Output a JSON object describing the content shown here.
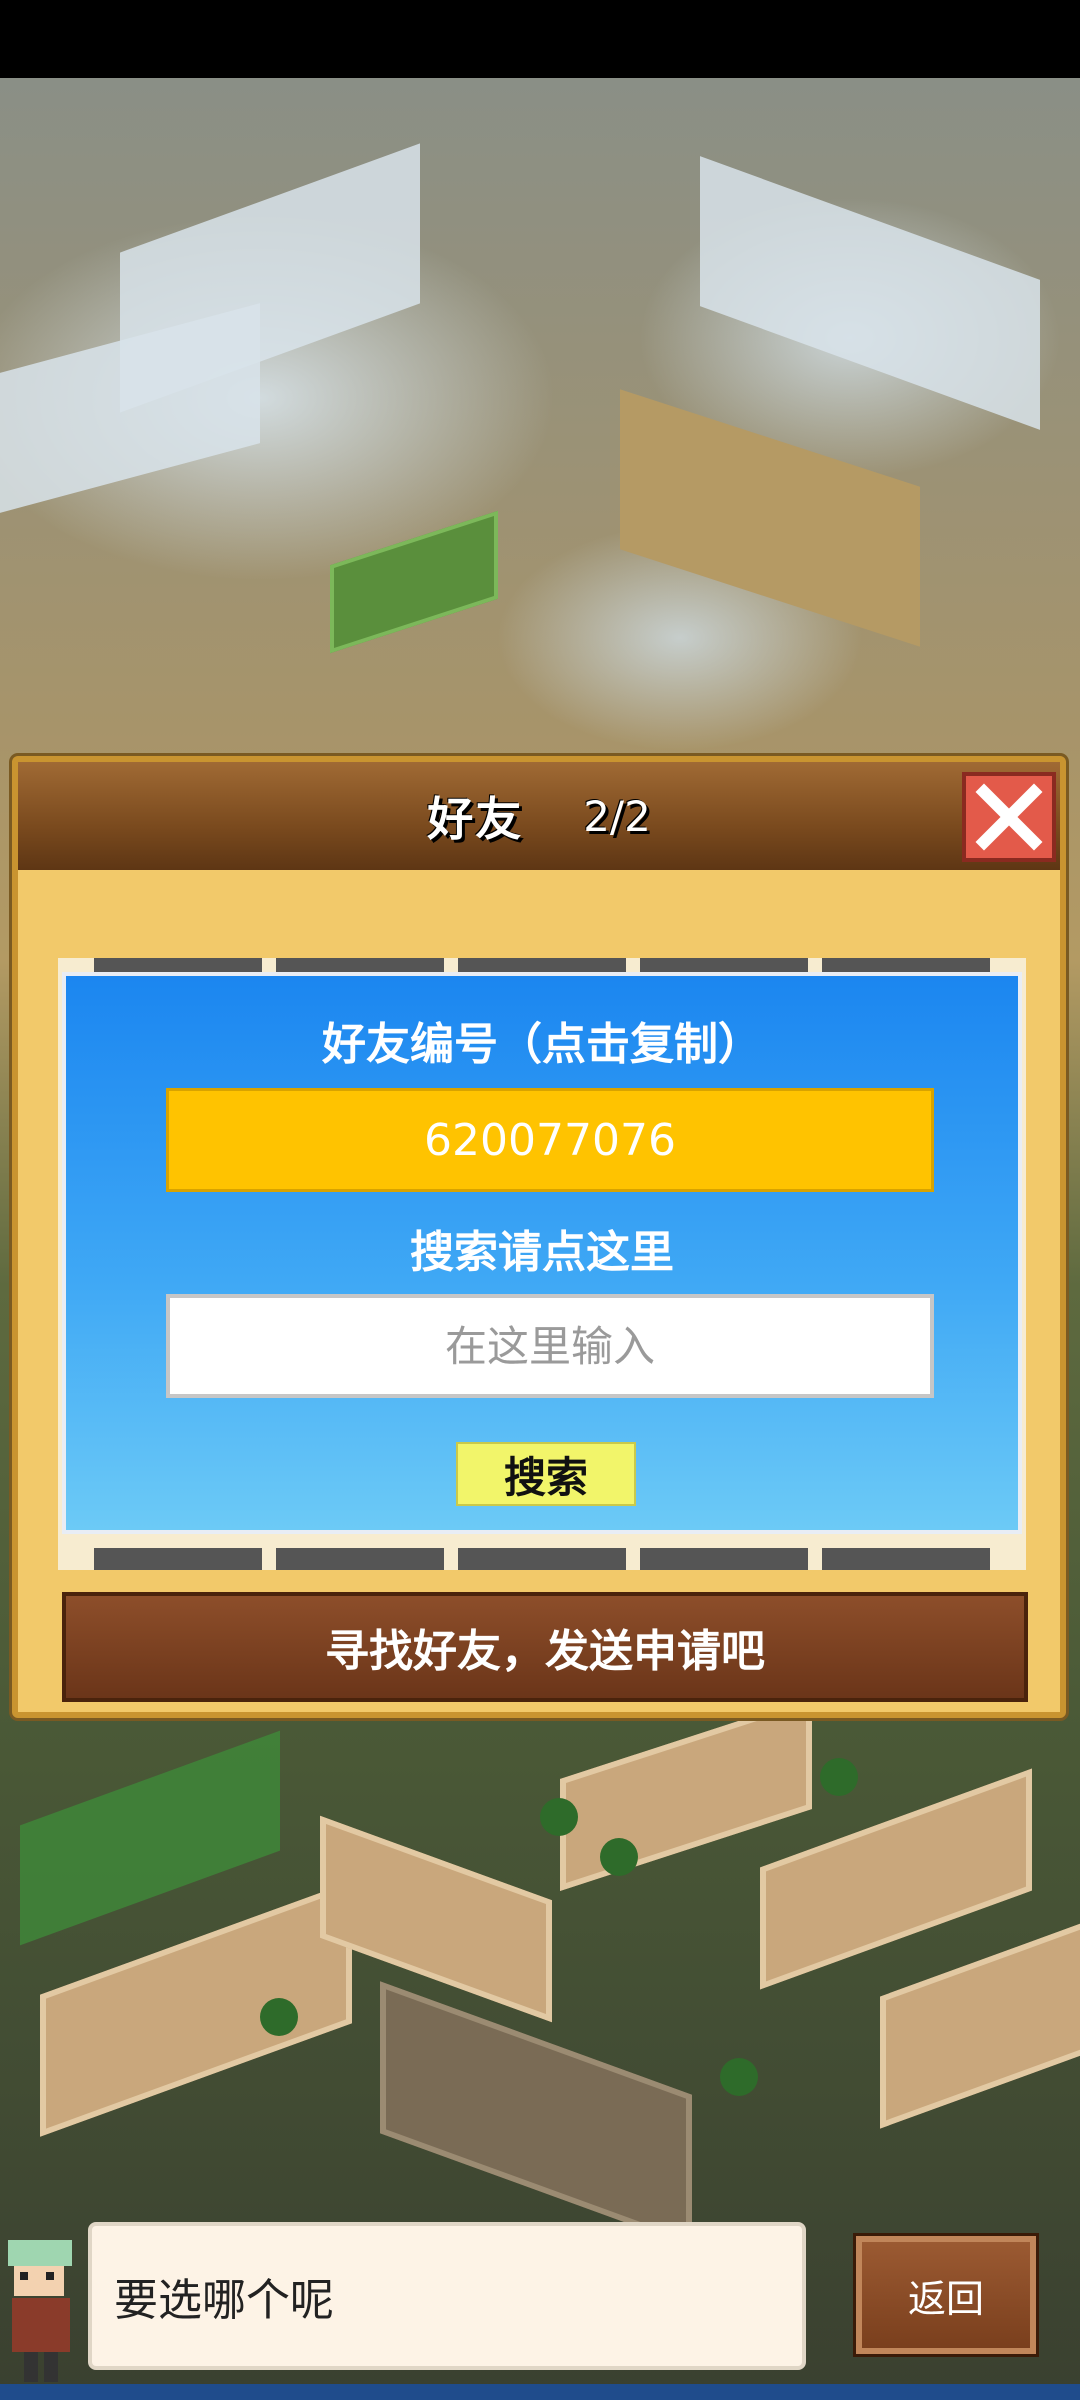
{
  "dialog": {
    "title": "好友",
    "count": "2/2",
    "friend_id_label": "好友编号（点击复制）",
    "friend_id": "620077076",
    "search_label": "搜索请点这里",
    "search_placeholder": "在这里输入",
    "search_button": "搜索",
    "find_friends_button": "寻找好友，发送申请吧",
    "close_icon": "close-x-icon"
  },
  "footer": {
    "speech_text": "要选哪个呢",
    "back_button": "返回"
  },
  "colors": {
    "id_box": "#ffc300",
    "panel_blue": "#1b86f0",
    "header_brown": "#7a4a1e",
    "close_red": "#e35a4a",
    "search_button": "#f2f56a"
  }
}
